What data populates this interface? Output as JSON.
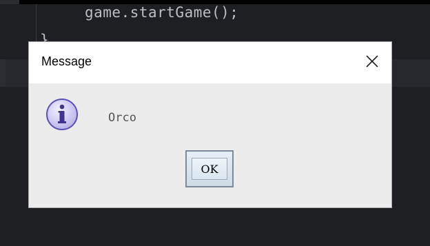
{
  "editor": {
    "code_line": "game.startGame();",
    "closing_brace": "}"
  },
  "dialog": {
    "title": "Message",
    "message": "Orco",
    "ok_label": "OK",
    "icon": "info-icon",
    "close_icon": "close-icon"
  },
  "colors": {
    "editor_bg": "#1e1f22",
    "dialog_bg": "#ececec",
    "titlebar_bg": "#ffffff",
    "info_icon_fill": "#c9c5f0",
    "info_icon_border": "#5b52b8"
  }
}
